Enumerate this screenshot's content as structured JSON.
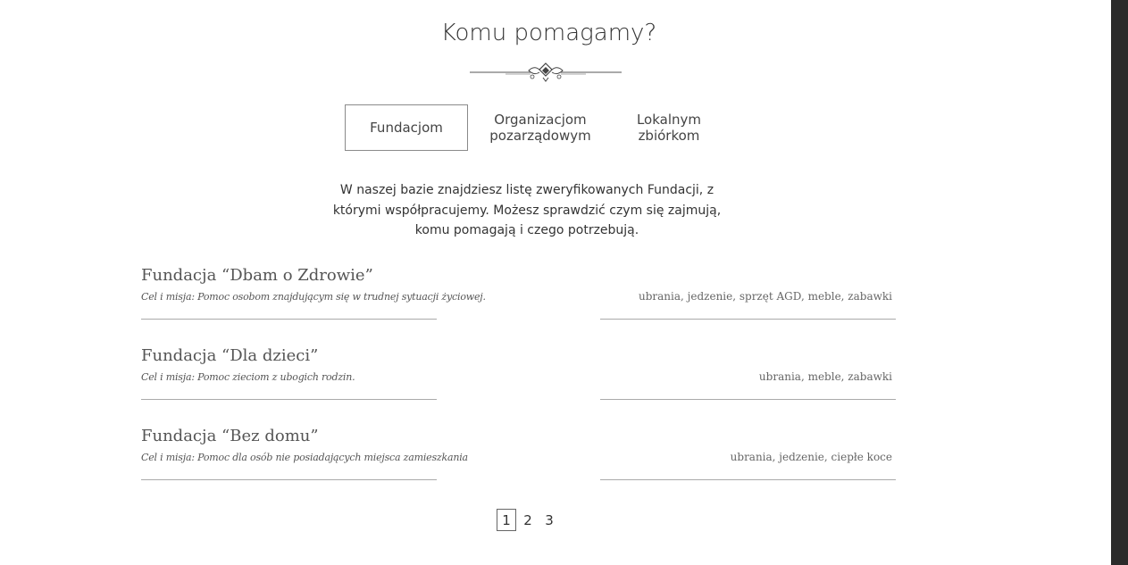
{
  "heading": "Komu pomagamy?",
  "tabs": [
    {
      "line1": "Fundacjom",
      "line2": ""
    },
    {
      "line1": "Organizacjom",
      "line2": "pozarządowym"
    },
    {
      "line1": "Lokalnym",
      "line2": "zbiórkom"
    }
  ],
  "intro": "W naszej bazie znajdziesz listę zweryfikowanych Fundacji, z którymi współpracujemy. Możesz sprawdzić czym się zajmują, komu pomagają i czego potrzebują.",
  "foundations": [
    {
      "name": "Fundacja  “Dbam o Zdrowie”",
      "mission": "Cel i misja: Pomoc osobom znajdującym się w trudnej sytuacji życiowej.",
      "needs": "ubrania, jedzenie, sprzęt AGD, meble, zabawki"
    },
    {
      "name": "Fundacja  “Dla dzieci”",
      "mission": "Cel i misja: Pomoc zieciom z ubogich rodzin.",
      "needs": "ubrania, meble, zabawki"
    },
    {
      "name": "Fundacja  “Bez domu”",
      "mission": "Cel i misja: Pomoc dla osób nie posiadających miejsca zamieszkania",
      "needs": "ubrania, jedzenie, ciepłe koce"
    }
  ],
  "pagination": {
    "pages": [
      "1",
      "2",
      "3"
    ],
    "current": "1"
  },
  "colors": {
    "text": "#333333",
    "divider": "#aaaaaa",
    "scrollbar": "#2b2b2b"
  }
}
